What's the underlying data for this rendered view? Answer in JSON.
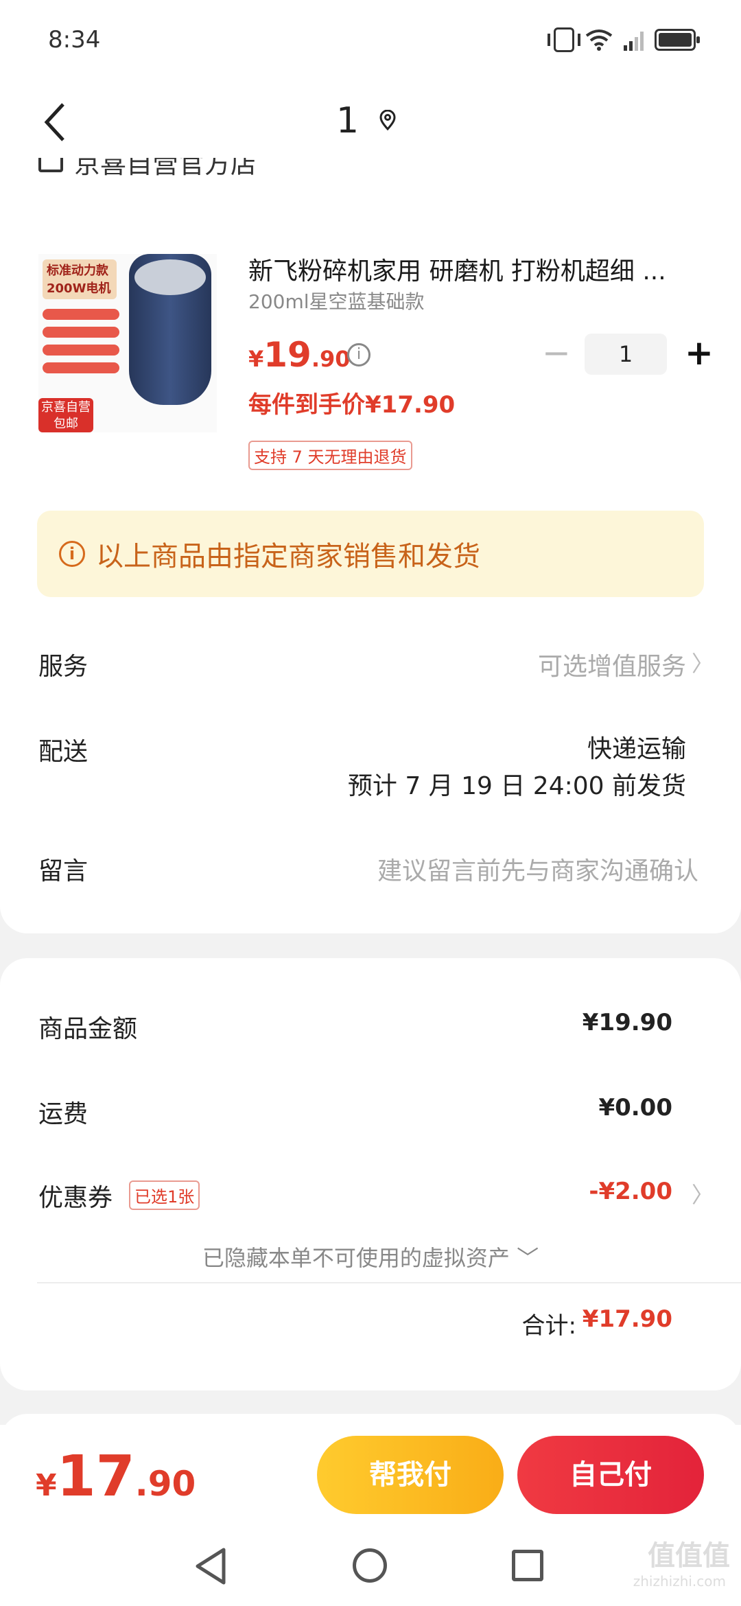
{
  "status_bar": {
    "time": "8:34",
    "network": "4G"
  },
  "header": {
    "title": "1"
  },
  "shop": {
    "name": "京喜自营官方店"
  },
  "product": {
    "image_badge": "标准动力款 200W电机",
    "image_tag": "京喜自营 包邮",
    "title": "新飞粉碎机家用 研磨机 打粉机超细 ...",
    "spec": "200ml星空蓝基础款",
    "price_symbol": "¥",
    "price_int": "19",
    "price_dec": ".90",
    "quantity": "1",
    "qty_minus": "−",
    "qty_plus": "+",
    "net_price": "每件到手价¥17.90",
    "return_policy": "支持 7 天无理由退货"
  },
  "notice": {
    "text": "以上商品由指定商家销售和发货"
  },
  "rows": {
    "service_label": "服务",
    "service_value": "可选增值服务",
    "delivery_label": "配送",
    "delivery_method": "快递运输",
    "delivery_eta": "预计 7 月 19 日 24:00 前发货",
    "message_label": "留言",
    "message_placeholder": "建议留言前先与商家沟通确认"
  },
  "summary": {
    "goods_label": "商品金额",
    "goods_value": "¥19.90",
    "shipping_label": "运费",
    "shipping_value": "¥0.00",
    "coupon_label": "优惠券",
    "coupon_tag": "已选1张",
    "coupon_value": "-¥2.00",
    "hidden_assets": "已隐藏本单不可使用的虚拟资产 ﹀",
    "total_label": "合计:",
    "total_value": "¥17.90"
  },
  "pay_bar": {
    "symbol": "¥",
    "int": "17",
    "dec": ".90",
    "help_pay": "帮我付",
    "self_pay": "自己付"
  },
  "watermark": {
    "main": "值值值",
    "sub": "zhizhizhi.com"
  },
  "colors": {
    "accent_red": "#e03c2a",
    "notice_bg": "#fdf6d9",
    "help_btn": "#ffcb2e",
    "self_btn": "#f03a42"
  }
}
